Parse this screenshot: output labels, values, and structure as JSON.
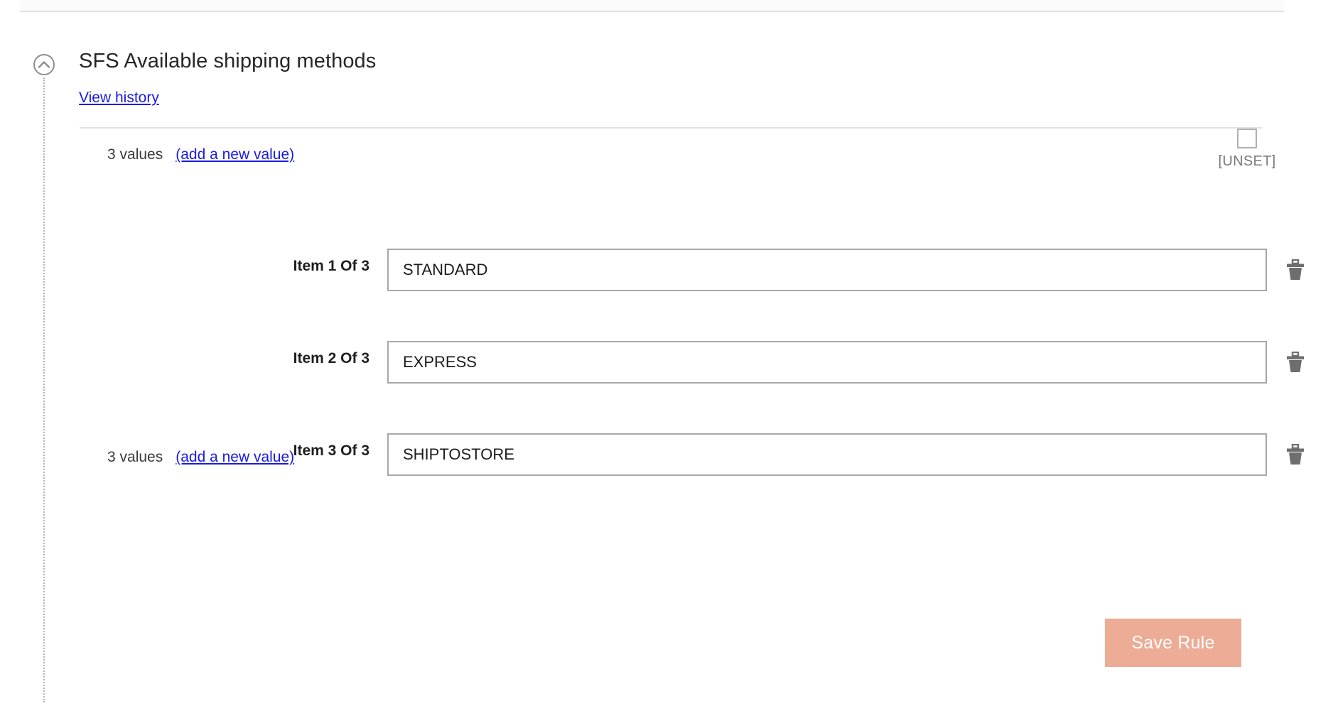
{
  "section": {
    "title": "SFS Available shipping methods",
    "history_link": "View history",
    "collapse_icon": "chevron-up-circle-icon"
  },
  "values_summary_top": {
    "count_label": "3 values",
    "add_link": "(add a new value)"
  },
  "values_summary_bottom": {
    "count_label": "3 values",
    "add_link": "(add a new value)"
  },
  "unset": {
    "label": "[UNSET]",
    "checked": false
  },
  "items": [
    {
      "label": "Item 1 Of 3",
      "value": "STANDARD",
      "delete_icon": "trash-icon"
    },
    {
      "label": "Item 2 Of 3",
      "value": "EXPRESS",
      "delete_icon": "trash-icon"
    },
    {
      "label": "Item 3 Of 3",
      "value": "SHIPTOSTORE",
      "delete_icon": "trash-icon"
    }
  ],
  "actions": {
    "save_label": "Save Rule"
  },
  "colors": {
    "link": "#1a1ae6",
    "save_button_bg": "#edac95",
    "save_button_text": "#ffffff",
    "input_border": "#a8a8a8",
    "divider": "#e2e2e2",
    "icon_gray": "#6e6e6e"
  }
}
